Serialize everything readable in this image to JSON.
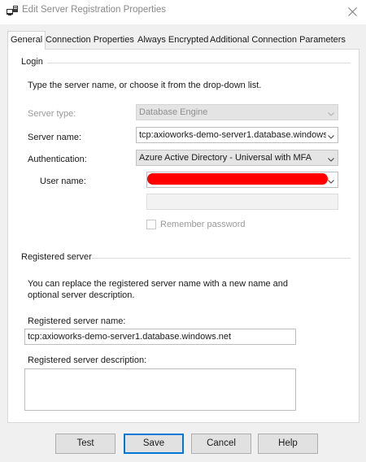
{
  "window": {
    "title": "Edit Server Registration Properties",
    "close_icon": "close-icon"
  },
  "tabs": [
    {
      "label": "General",
      "active": true
    },
    {
      "label": "Connection Properties",
      "active": false
    },
    {
      "label": "Always Encrypted",
      "active": false
    },
    {
      "label": "Additional Connection Parameters",
      "active": false
    }
  ],
  "login": {
    "group_title": "Login",
    "instructions": "Type the server name, or choose it from the drop-down list.",
    "server_type_label": "Server type:",
    "server_type_value": "Database Engine",
    "server_name_label": "Server name:",
    "server_name_value": "tcp:axioworks-demo-server1.database.windows.",
    "authentication_label": "Authentication:",
    "authentication_value": "Azure Active Directory - Universal with MFA",
    "user_name_label": "User name:",
    "remember_password_label": "Remember password",
    "remember_password_checked": false
  },
  "registered": {
    "group_title": "Registered server",
    "instructions_line1": "You can replace the registered server name with a new name and",
    "instructions_line2": "optional server description.",
    "name_label": "Registered server name:",
    "name_value": "tcp:axioworks-demo-server1.database.windows.net",
    "description_label": "Registered server description:",
    "description_value": ""
  },
  "buttons": {
    "test": "Test",
    "save": "Save",
    "cancel": "Cancel",
    "help": "Help"
  },
  "colors": {
    "accent": "#0078d7",
    "redaction": "#ff0000"
  }
}
